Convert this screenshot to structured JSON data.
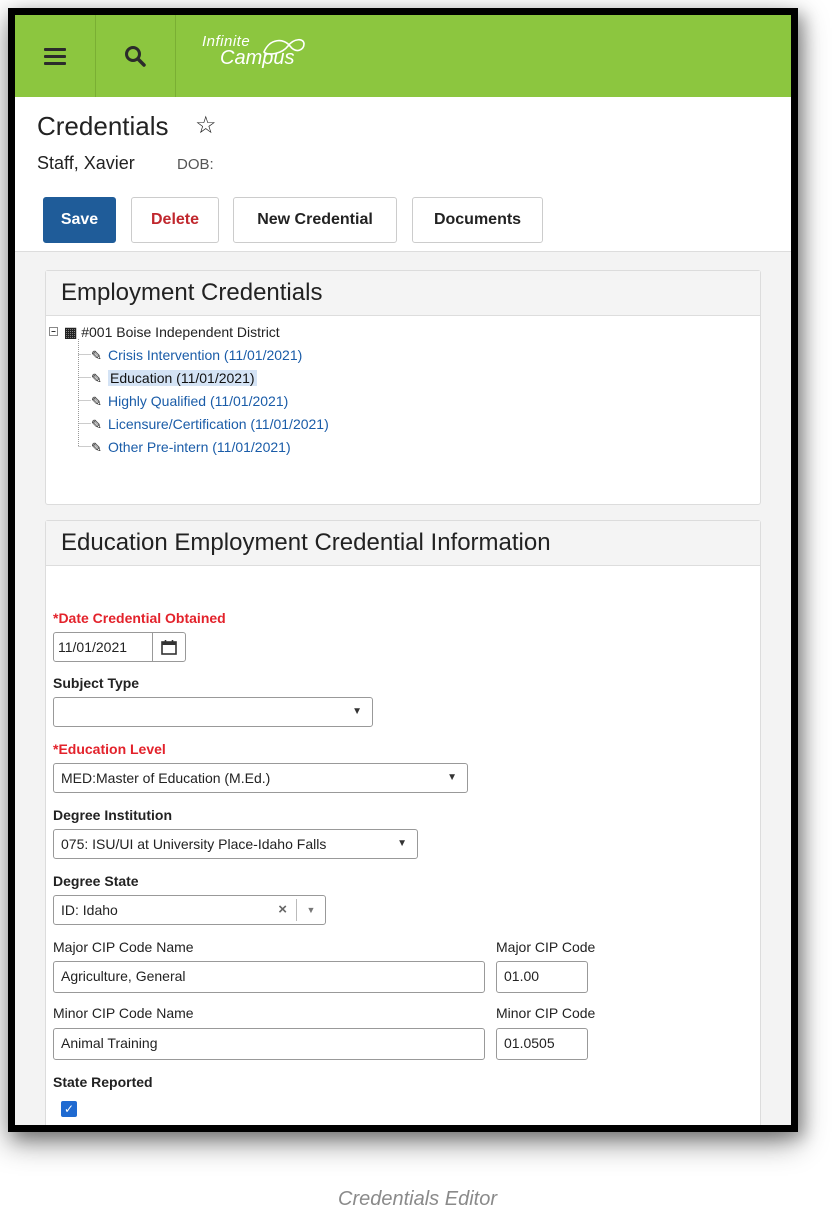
{
  "app": {
    "brand_line1": "Infinite",
    "brand_line2": "Campus"
  },
  "header": {
    "title": "Credentials",
    "person": "Staff, Xavier",
    "dob_label": "DOB:"
  },
  "toolbar": {
    "save": "Save",
    "delete": "Delete",
    "new_credential": "New Credential",
    "documents": "Documents"
  },
  "employment_credentials": {
    "heading": "Employment Credentials",
    "root": "#001 Boise Independent District",
    "items": [
      {
        "label": "Crisis Intervention (11/01/2021)",
        "selected": false
      },
      {
        "label": "Education (11/01/2021)",
        "selected": true
      },
      {
        "label": "Highly Qualified (11/01/2021)",
        "selected": false
      },
      {
        "label": "Licensure/Certification (11/01/2021)",
        "selected": false
      },
      {
        "label": "Other Pre-intern (11/01/2021)",
        "selected": false
      }
    ]
  },
  "detail": {
    "heading": "Education Employment Credential Information",
    "date_obtained": {
      "label": "*Date Credential Obtained",
      "value": "11/01/2021"
    },
    "subject_type": {
      "label": "Subject Type",
      "value": ""
    },
    "education_level": {
      "label": "*Education Level",
      "value": "MED:Master of Education (M.Ed.)"
    },
    "degree_institution": {
      "label": "Degree Institution",
      "value": "075: ISU/UI at University Place-Idaho Falls"
    },
    "degree_state": {
      "label": "Degree State",
      "value": "ID: Idaho"
    },
    "major_cip_name": {
      "label": "Major CIP Code Name",
      "value": "Agriculture, General"
    },
    "major_cip_code": {
      "label": "Major CIP Code",
      "value": "01.00"
    },
    "minor_cip_name": {
      "label": "Minor CIP Code Name",
      "value": "Animal Training"
    },
    "minor_cip_code": {
      "label": "Minor CIP Code",
      "value": "01.0505"
    },
    "state_reported": {
      "label": "State Reported",
      "checked": true
    }
  },
  "caption": "Credentials Editor",
  "colors": {
    "topbar": "#8cc63f",
    "save": "#1f5c99",
    "required": "#e3222b",
    "link": "#1a5ca8"
  }
}
